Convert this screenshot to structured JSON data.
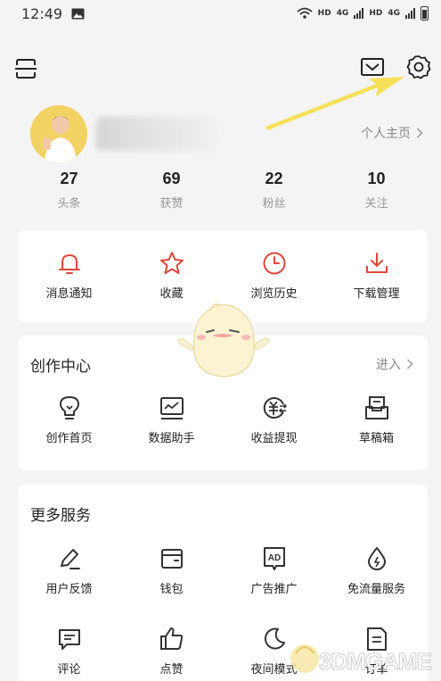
{
  "status_bar": {
    "time": "12:49",
    "network1": "HD",
    "network1_type": "4G",
    "network2": "HD",
    "network2_type": "4G"
  },
  "profile": {
    "homepage_link": "个人主页",
    "stats": [
      {
        "value": "27",
        "label": "头条"
      },
      {
        "value": "69",
        "label": "获赞"
      },
      {
        "value": "22",
        "label": "粉丝"
      },
      {
        "value": "10",
        "label": "关注"
      }
    ]
  },
  "quick_actions": [
    {
      "label": "消息通知",
      "icon": "bell-icon"
    },
    {
      "label": "收藏",
      "icon": "star-icon"
    },
    {
      "label": "浏览历史",
      "icon": "clock-icon"
    },
    {
      "label": "下载管理",
      "icon": "download-icon"
    }
  ],
  "creation_center": {
    "title": "创作中心",
    "enter_label": "进入",
    "items": [
      {
        "label": "创作首页",
        "icon": "lightbulb-icon"
      },
      {
        "label": "数据助手",
        "icon": "chart-icon"
      },
      {
        "label": "收益提现",
        "icon": "yuan-icon"
      },
      {
        "label": "草稿箱",
        "icon": "drafts-icon"
      }
    ]
  },
  "more_services": {
    "title": "更多服务",
    "items": [
      {
        "label": "用户反馈",
        "icon": "pen-icon"
      },
      {
        "label": "钱包",
        "icon": "wallet-icon"
      },
      {
        "label": "广告推广",
        "icon": "ad-icon"
      },
      {
        "label": "免流量服务",
        "icon": "drop-icon"
      },
      {
        "label": "评论",
        "icon": "comment-icon"
      },
      {
        "label": "点赞",
        "icon": "thumbs-up-icon"
      },
      {
        "label": "夜间模式",
        "icon": "moon-icon"
      },
      {
        "label": "订单",
        "icon": "order-icon"
      }
    ]
  },
  "watermark": {
    "text": "3DMGAME"
  },
  "colors": {
    "accent_red": "#e0473d",
    "dark_icon": "#333333",
    "arrow_yellow": "#f6e05a"
  }
}
